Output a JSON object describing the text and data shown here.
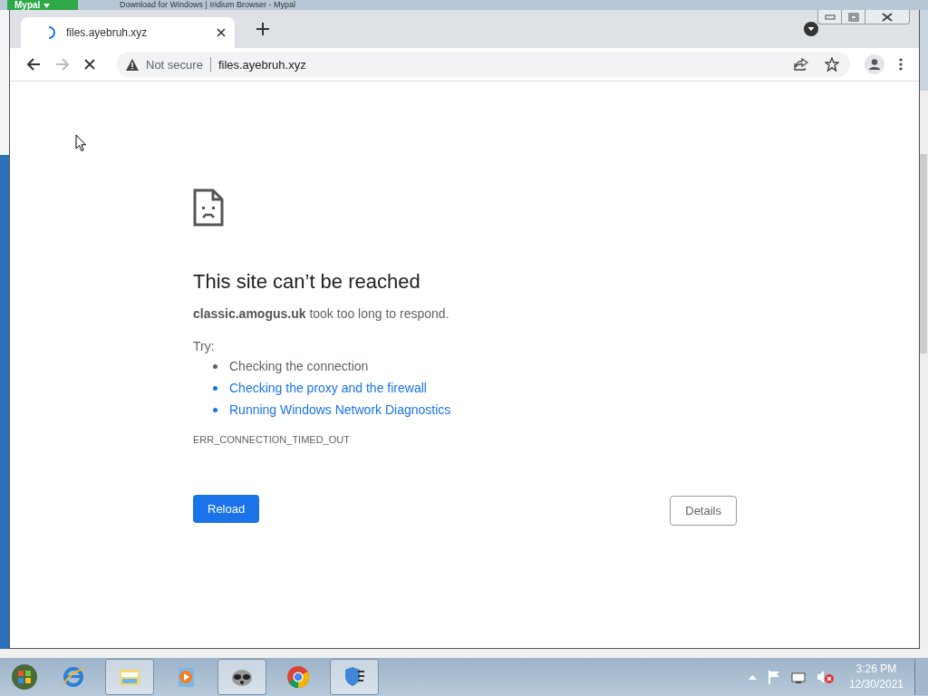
{
  "background_window": {
    "menu_button": "Mypal",
    "title": "Download for Windows | Iridium Browser - Mypal"
  },
  "tab": {
    "title": "files.ayebruh.xyz",
    "loading": true
  },
  "address_bar": {
    "security": "Not secure",
    "url": "files.ayebruh.xyz"
  },
  "error": {
    "heading": "This site can’t be reached",
    "message": "**classic.amogus.uk** took too long to respond.",
    "try_label": "Try:",
    "suggestions": [
      {
        "text": "Checking the connection",
        "link": false
      },
      {
        "text": "Checking the proxy and the firewall",
        "link": true
      },
      {
        "text": "Running Windows Network Diagnostics",
        "link": true
      }
    ],
    "code": "ERR_CONNECTION_TIMED_OUT",
    "reload_button": "Reload",
    "details_button": "Details"
  },
  "taskbar": {
    "apps": [
      {
        "kind": "ie",
        "open": false
      },
      {
        "kind": "explorer",
        "open": true
      },
      {
        "kind": "media",
        "open": false
      },
      {
        "kind": "raccoon",
        "open": true
      },
      {
        "kind": "chrome",
        "open": false
      },
      {
        "kind": "shield",
        "open": true
      }
    ],
    "clock": {
      "time": "3:26 PM",
      "date": "12/30/2021"
    }
  }
}
